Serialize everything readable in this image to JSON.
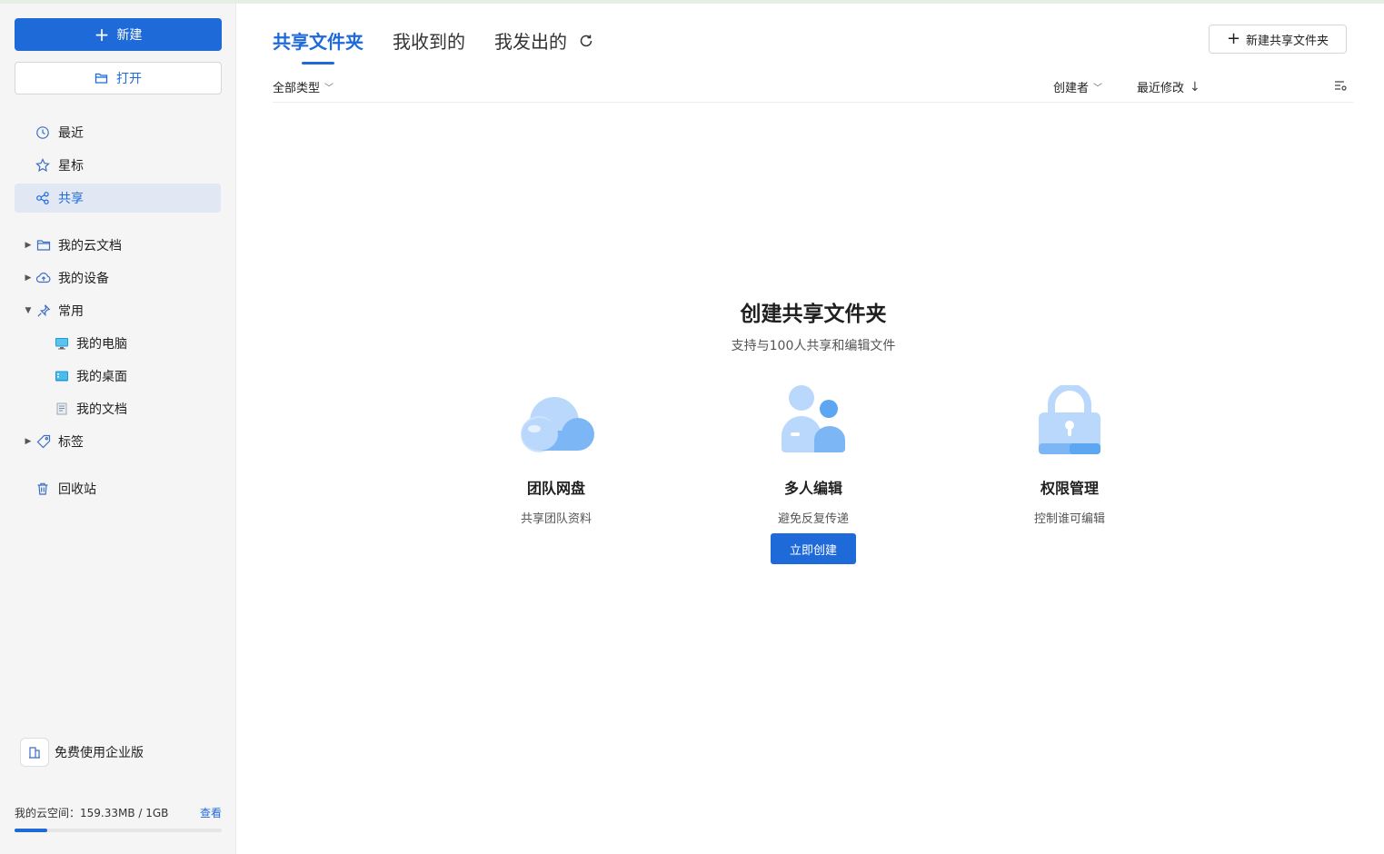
{
  "sidebar": {
    "new_label": "新建",
    "open_label": "打开",
    "nav": [
      {
        "label": "最近",
        "icon": "clock-icon"
      },
      {
        "label": "星标",
        "icon": "star-icon"
      },
      {
        "label": "共享",
        "icon": "share-icon",
        "active": true
      }
    ],
    "tree": [
      {
        "label": "我的云文档",
        "icon": "folder-icon",
        "expanded": false
      },
      {
        "label": "我的设备",
        "icon": "cloud-upload-icon",
        "expanded": false
      },
      {
        "label": "常用",
        "icon": "pin-icon",
        "expanded": true
      },
      {
        "label": "标签",
        "icon": "tag-icon",
        "expanded": false
      }
    ],
    "common_items": [
      {
        "label": "我的电脑",
        "icon": "computer-icon"
      },
      {
        "label": "我的桌面",
        "icon": "desktop-icon"
      },
      {
        "label": "我的文档",
        "icon": "document-icon"
      }
    ],
    "trash_label": "回收站",
    "enterprise_label": "免费使用企业版",
    "storage": {
      "label": "我的云空间：159.33MB / 1GB",
      "view_label": "查看",
      "used_fraction": 0.16
    }
  },
  "header": {
    "tabs": [
      {
        "label": "共享文件夹",
        "active": true
      },
      {
        "label": "我收到的",
        "active": false
      },
      {
        "label": "我发出的",
        "active": false
      }
    ],
    "new_shared_folder_label": "新建共享文件夹"
  },
  "filters": {
    "type_label": "全部类型",
    "creator_label": "创建者",
    "sort_label": "最近修改"
  },
  "empty_state": {
    "title": "创建共享文件夹",
    "subtitle": "支持与100人共享和编辑文件",
    "features": [
      {
        "name": "团队网盘",
        "desc": "共享团队资料",
        "icon": "cloud-icon"
      },
      {
        "name": "多人编辑",
        "desc": "避免反复传递",
        "icon": "users-icon"
      },
      {
        "name": "权限管理",
        "desc": "控制谁可编辑",
        "icon": "lock-icon"
      }
    ],
    "create_label": "立即创建"
  },
  "colors": {
    "accent": "#1f6ad9",
    "active_bg": "#e1e8f3",
    "illustration_light": "#b9d8fb",
    "illustration_mid": "#7db6f5"
  }
}
